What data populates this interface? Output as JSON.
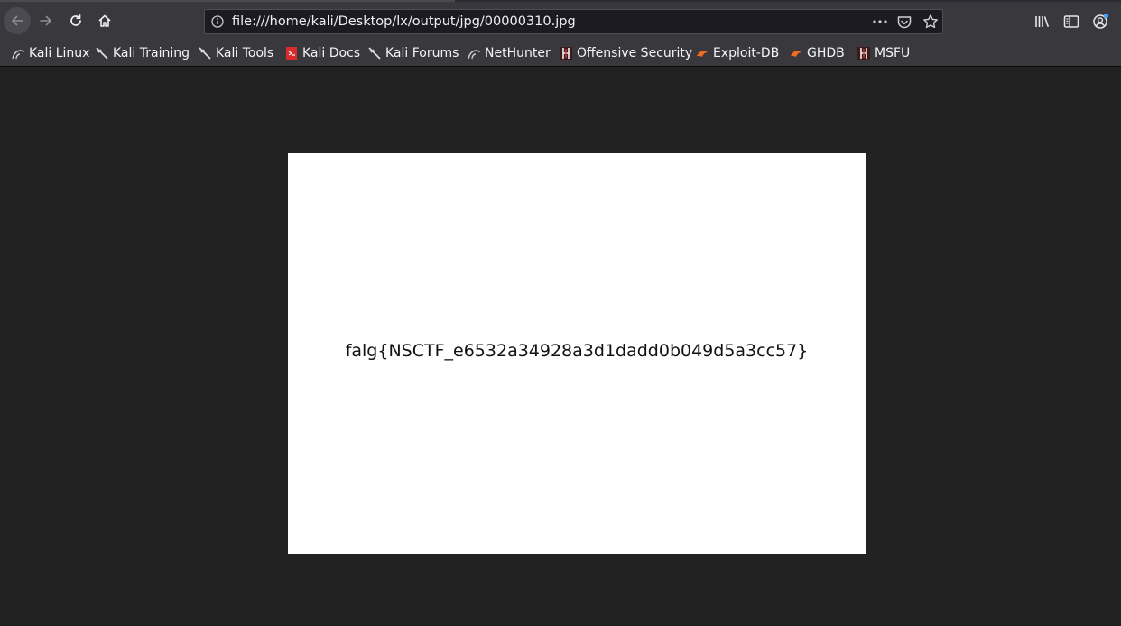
{
  "browser": {
    "url": "file:///home/kali/Desktop/lx/output/jpg/00000310.jpg",
    "colors": {
      "toolbar": "#38383d",
      "urlbar": "#1c1b22",
      "content_bg": "#222222",
      "account_dot": "#45a1ff"
    }
  },
  "navigation": {
    "back_icon": "arrow-left-icon",
    "forward_icon": "arrow-right-icon",
    "reload_icon": "reload-icon",
    "home_icon": "home-icon"
  },
  "bookmarks": [
    {
      "label": "Kali Linux",
      "icon": "kali-dragon-icon"
    },
    {
      "label": "Kali Training",
      "icon": "kali-sword-icon"
    },
    {
      "label": "Kali Tools",
      "icon": "kali-sword-icon"
    },
    {
      "label": "Kali Docs",
      "icon": "kali-docs-icon"
    },
    {
      "label": "Kali Forums",
      "icon": "kali-sword-icon"
    },
    {
      "label": "NetHunter",
      "icon": "kali-dragon-icon"
    },
    {
      "label": "Offensive Security",
      "icon": "offsec-icon"
    },
    {
      "label": "Exploit-DB",
      "icon": "exploitdb-icon"
    },
    {
      "label": "GHDB",
      "icon": "exploitdb-icon"
    },
    {
      "label": "MSFU",
      "icon": "offsec-icon"
    }
  ],
  "document": {
    "text": "falg{NSCTF_e6532a34928a3d1dadd0b049d5a3cc57}"
  }
}
